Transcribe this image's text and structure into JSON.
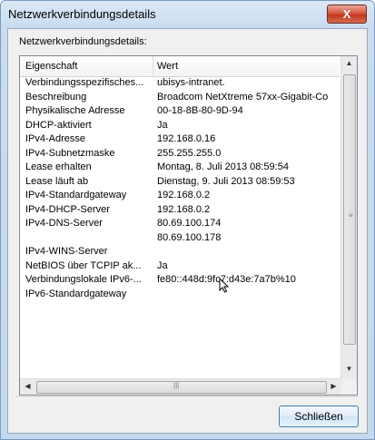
{
  "window": {
    "title": "Netzwerkverbindungsdetails",
    "close_glyph": "X"
  },
  "group_label": "Netzwerkverbindungsdetails:",
  "columns": {
    "property": "Eigenschaft",
    "value": "Wert"
  },
  "rows": [
    {
      "property": "Verbindungsspezifisches...",
      "value": "ubisys-intranet."
    },
    {
      "property": "Beschreibung",
      "value": "Broadcom NetXtreme 57xx-Gigabit-Co"
    },
    {
      "property": "Physikalische Adresse",
      "value": "00-18-8B-80-9D-94"
    },
    {
      "property": "DHCP-aktiviert",
      "value": "Ja"
    },
    {
      "property": "IPv4-Adresse",
      "value": "192.168.0.16"
    },
    {
      "property": "IPv4-Subnetzmaske",
      "value": "255.255.255.0"
    },
    {
      "property": "Lease erhalten",
      "value": "Montag, 8. Juli 2013 08:59:54"
    },
    {
      "property": "Lease läuft ab",
      "value": "Dienstag, 9. Juli 2013 08:59:53"
    },
    {
      "property": "IPv4-Standardgateway",
      "value": "192.168.0.2"
    },
    {
      "property": "IPv4-DHCP-Server",
      "value": "192.168.0.2"
    },
    {
      "property": "IPv4-DNS-Server",
      "value": "80.69.100.174"
    },
    {
      "property": "",
      "value": "80.69.100.178"
    },
    {
      "property": "IPv4-WINS-Server",
      "value": ""
    },
    {
      "property": "NetBIOS über TCPIP ak...",
      "value": "Ja"
    },
    {
      "property": "Verbindungslokale IPv6-...",
      "value": "fe80::448d:9fc7:d43e:7a7b%10"
    },
    {
      "property": "IPv6-Standardgateway",
      "value": ""
    }
  ],
  "close_button": "Schließen",
  "icons": {
    "up": "scroll-up-arrow",
    "down": "scroll-down-arrow",
    "left": "scroll-left-arrow",
    "right": "scroll-right-arrow"
  }
}
